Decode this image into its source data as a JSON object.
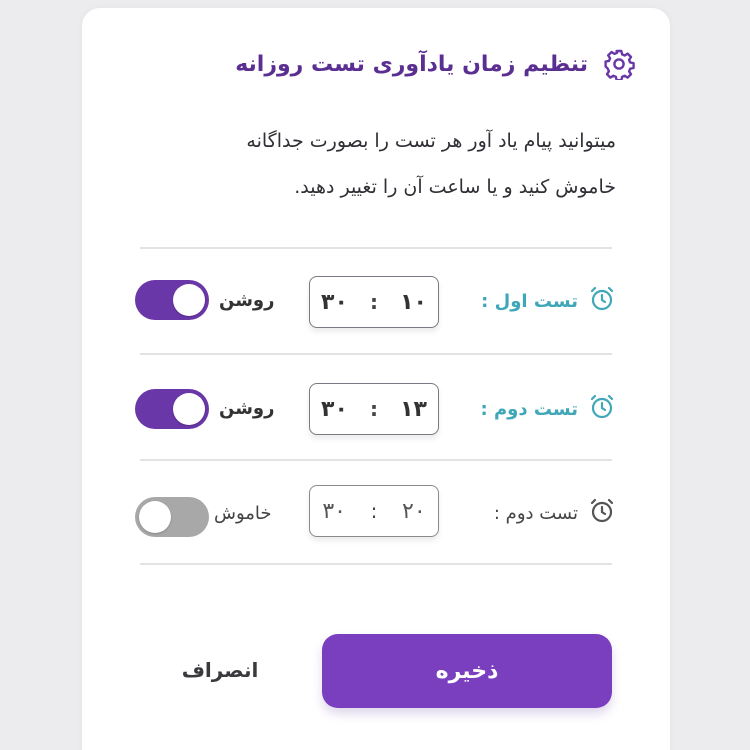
{
  "header": {
    "title": "تنظیم زمان یادآوری تست روزانه",
    "icon": "gear-icon"
  },
  "description": {
    "line1": "میتوانید پیام یاد آور هر تست را بصورت جداگانه",
    "line2": "خاموش کنید و یا ساعت آن را تغییر دهید."
  },
  "reminders": [
    {
      "label": "تست اول :",
      "hour": "۱۰",
      "minute": "۳۰",
      "separator": ":",
      "state_label": "روشن",
      "enabled": true,
      "icon": "alarm-clock-icon"
    },
    {
      "label": "تست دوم :",
      "hour": "۱۳",
      "minute": "۳۰",
      "separator": ":",
      "state_label": "روشن",
      "enabled": true,
      "icon": "alarm-clock-icon"
    },
    {
      "label": "تست دوم :",
      "hour": "۲۰",
      "minute": "۳۰",
      "separator": ":",
      "state_label": "خاموش",
      "enabled": false,
      "icon": "alarm-clock-icon"
    }
  ],
  "actions": {
    "save_label": "ذخیره",
    "cancel_label": "انصراف"
  },
  "colors": {
    "accent": "#7a3fbf",
    "title": "#5b2e91",
    "toggle_on": "#6a37a8",
    "toggle_off": "#a8a8a8",
    "label_active": "#3fa7b7"
  }
}
